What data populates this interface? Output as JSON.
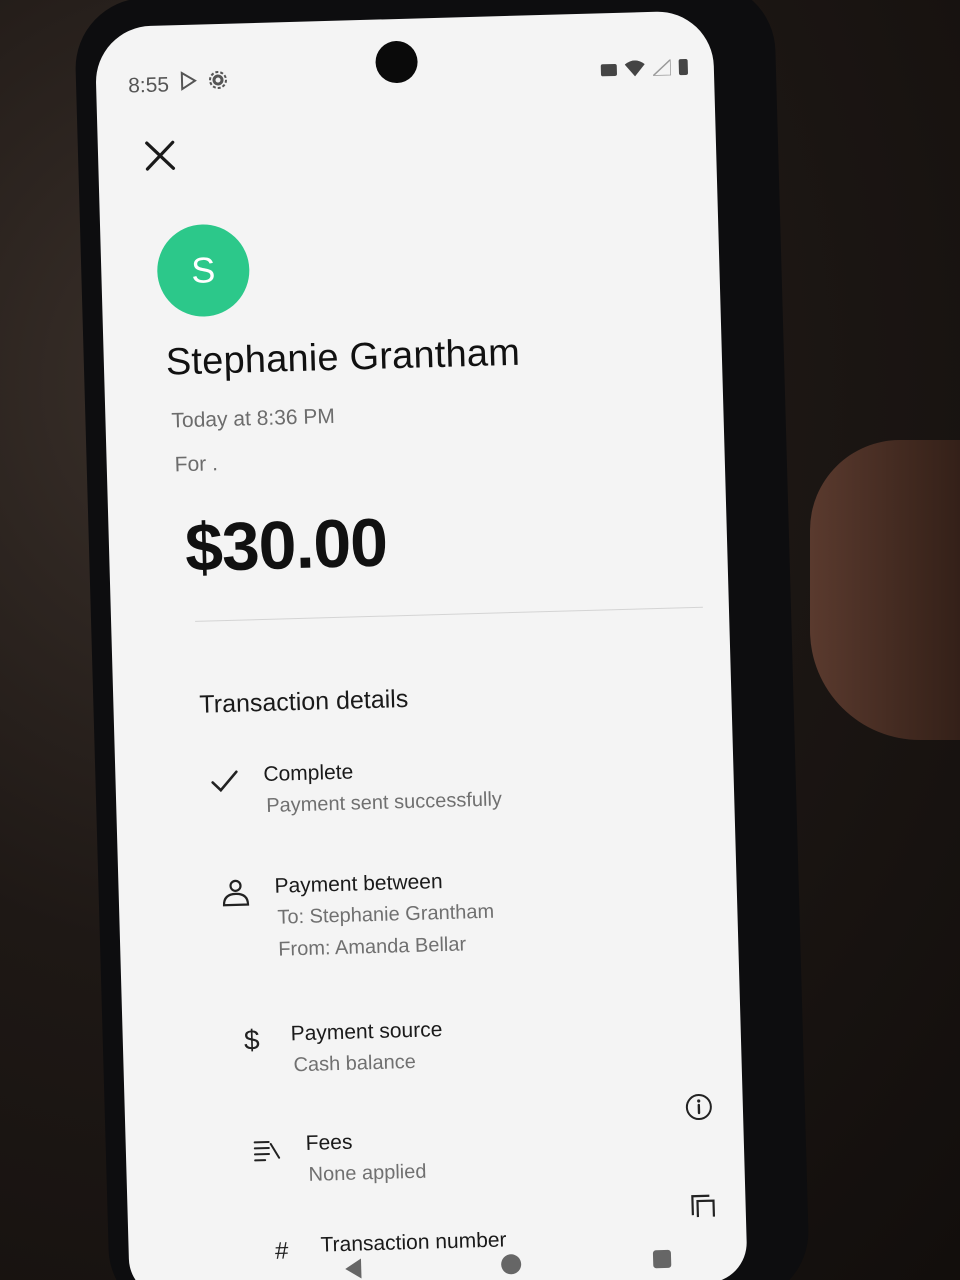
{
  "status_bar": {
    "time": "8:55"
  },
  "header": {
    "avatar_initial": "S",
    "recipient_name": "Stephanie Grantham",
    "timestamp": "Today at 8:36 PM",
    "note": "For .",
    "amount": "$30.00"
  },
  "colors": {
    "avatar_bg": "#2cc88a",
    "text_primary": "#111111",
    "text_secondary": "#6c6c6c"
  },
  "details": {
    "section_title": "Transaction details",
    "status": {
      "icon": "check-icon",
      "title": "Complete",
      "subtitle": "Payment sent successfully"
    },
    "parties": {
      "icon": "person-icon",
      "title": "Payment between",
      "to": "To: Stephanie Grantham",
      "from": "From: Amanda Bellar"
    },
    "source": {
      "icon": "dollar-icon",
      "title": "Payment source",
      "subtitle": "Cash balance"
    },
    "fees": {
      "icon": "fees-list-icon",
      "title": "Fees",
      "subtitle": "None applied"
    },
    "transaction_number": {
      "icon": "hash-icon",
      "title": "Transaction number"
    }
  }
}
